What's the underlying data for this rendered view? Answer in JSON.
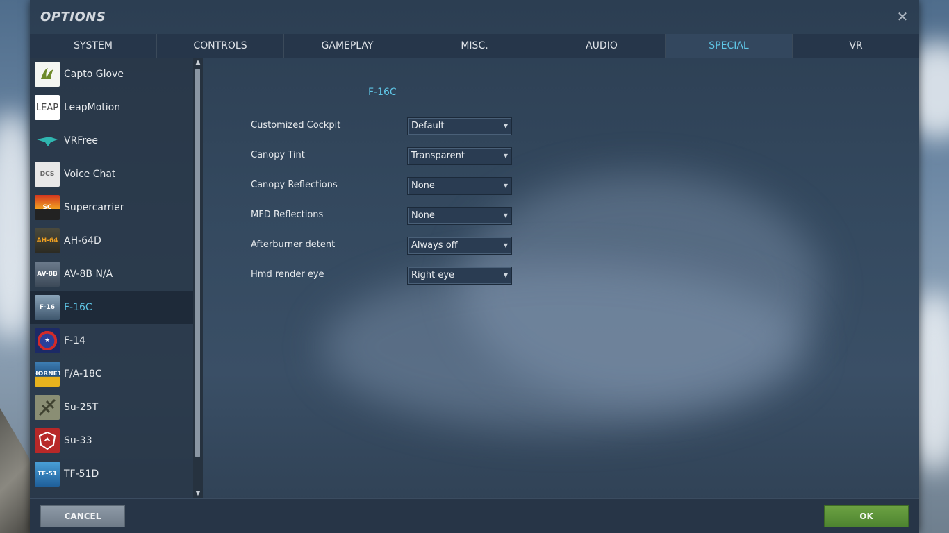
{
  "window": {
    "title": "OPTIONS"
  },
  "tabs": [
    {
      "label": "SYSTEM",
      "active": false
    },
    {
      "label": "CONTROLS",
      "active": false
    },
    {
      "label": "GAMEPLAY",
      "active": false
    },
    {
      "label": "MISC.",
      "active": false
    },
    {
      "label": "AUDIO",
      "active": false
    },
    {
      "label": "SPECIAL",
      "active": true
    },
    {
      "label": "VR",
      "active": false
    }
  ],
  "sidebar": {
    "items": [
      {
        "label": "Capto Glove",
        "icon": "capto-glove-icon",
        "active": false
      },
      {
        "label": "LeapMotion",
        "icon": "leapmotion-icon",
        "active": false
      },
      {
        "label": "VRFree",
        "icon": "vrfree-icon",
        "active": false
      },
      {
        "label": "Voice Chat",
        "icon": "voice-chat-icon",
        "active": false
      },
      {
        "label": "Supercarrier",
        "icon": "supercarrier-icon",
        "active": false
      },
      {
        "label": "AH-64D",
        "icon": "ah-64d-icon",
        "active": false
      },
      {
        "label": "AV-8B N/A",
        "icon": "av-8b-icon",
        "active": false
      },
      {
        "label": "F-16C",
        "icon": "f-16c-icon",
        "active": true
      },
      {
        "label": "F-14",
        "icon": "f-14-icon",
        "active": false
      },
      {
        "label": "F/A-18C",
        "icon": "fa-18c-icon",
        "active": false
      },
      {
        "label": "Su-25T",
        "icon": "su-25t-icon",
        "active": false
      },
      {
        "label": "Su-33",
        "icon": "su-33-icon",
        "active": false
      },
      {
        "label": "TF-51D",
        "icon": "tf-51d-icon",
        "active": false
      }
    ]
  },
  "content": {
    "section_title": "F-16C",
    "options": [
      {
        "label": "Customized Cockpit",
        "value": "Default"
      },
      {
        "label": "Canopy Tint",
        "value": "Transparent"
      },
      {
        "label": "Canopy Reflections",
        "value": "None"
      },
      {
        "label": "MFD Reflections",
        "value": "None"
      },
      {
        "label": "Afterburner detent",
        "value": "Always off"
      },
      {
        "label": "Hmd render eye",
        "value": "Right eye"
      }
    ]
  },
  "footer": {
    "cancel_label": "CANCEL",
    "ok_label": "OK"
  },
  "colors": {
    "accent": "#5fc6e6",
    "ok": "#5c9438",
    "cancel": "#7f8b97"
  }
}
